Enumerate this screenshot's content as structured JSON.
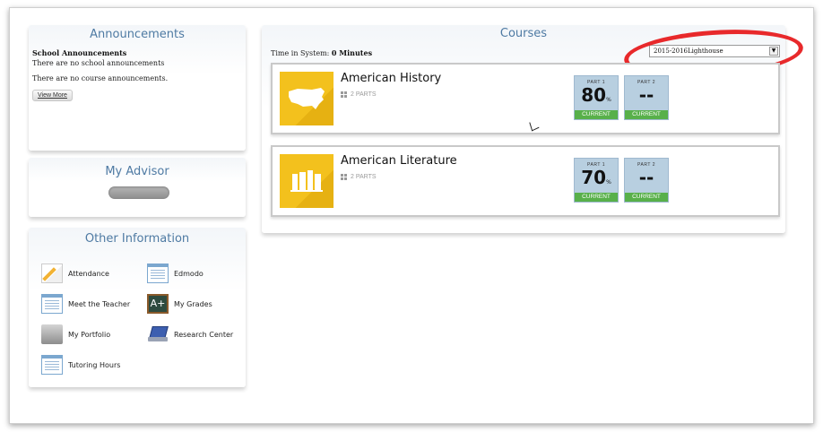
{
  "announcements": {
    "title": "Announcements",
    "school_heading": "School Announcements",
    "school_text": "There are no school announcements",
    "course_text": "There are no course announcements.",
    "view_more": "View More"
  },
  "advisor": {
    "title": "My Advisor"
  },
  "other_information": {
    "title": "Other Information",
    "links": [
      {
        "label": "Attendance",
        "icon": "attendance-icon"
      },
      {
        "label": "Edmodo",
        "icon": "edmodo-icon"
      },
      {
        "label": "Meet the Teacher",
        "icon": "meet-teacher-icon"
      },
      {
        "label": "My Grades",
        "icon": "grades-icon"
      },
      {
        "label": "My Portfolio",
        "icon": "portfolio-icon"
      },
      {
        "label": "Research Center",
        "icon": "laptop-icon"
      },
      {
        "label": "Tutoring Hours",
        "icon": "tutoring-icon"
      }
    ]
  },
  "courses": {
    "title": "Courses",
    "time_label": "Time in System:",
    "time_value": "0 Minutes",
    "term_select": "2015-2016Lighthouse",
    "items": [
      {
        "title": "American History",
        "parts": "2 PARTS",
        "icon": "usa-map-icon",
        "part1": {
          "label": "PART 1",
          "score": "80",
          "unit": "%",
          "status": "CURRENT"
        },
        "part2": {
          "label": "PART 2",
          "score": "--",
          "status": "CURRENT"
        }
      },
      {
        "title": "American Literature",
        "parts": "2 PARTS",
        "icon": "books-icon",
        "part1": {
          "label": "PART 1",
          "score": "70",
          "unit": "%",
          "status": "CURRENT"
        },
        "part2": {
          "label": "PART 2",
          "score": "--",
          "status": "CURRENT"
        }
      }
    ]
  },
  "colors": {
    "panel_title": "#4e7aa3",
    "course_tile": "#b8cfe0",
    "status_green": "#58b04a",
    "course_thumb": "#f3c11d",
    "highlight_red": "#e8292b"
  }
}
